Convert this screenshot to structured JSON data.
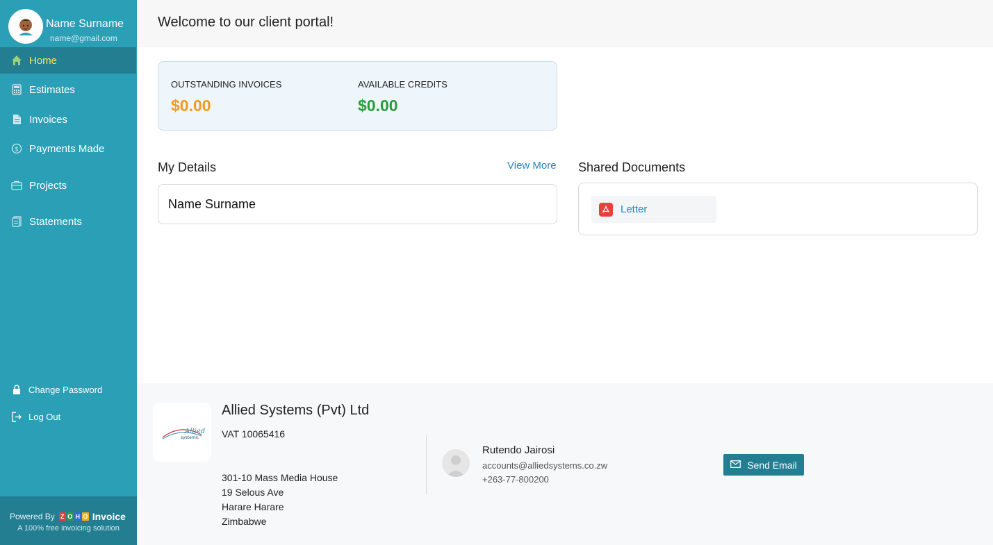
{
  "user": {
    "name": "Name Surname",
    "email": "name@gmail.com"
  },
  "sidebar": {
    "items": [
      {
        "label": "Home",
        "icon": "home-icon",
        "active": true
      },
      {
        "label": "Estimates",
        "icon": "calculator-icon"
      },
      {
        "label": "Invoices",
        "icon": "document-icon"
      },
      {
        "label": "Payments Made",
        "icon": "dollar-circle-icon"
      },
      {
        "label": "Projects",
        "icon": "briefcase-icon"
      },
      {
        "label": "Statements",
        "icon": "statement-icon"
      }
    ],
    "bottom": [
      {
        "label": "Change Password",
        "icon": "lock-icon"
      },
      {
        "label": "Log Out",
        "icon": "logout-icon"
      }
    ],
    "powered_by": {
      "text": "Powered By",
      "brand": "Invoice",
      "zoho_letters": [
        "Z",
        "O",
        "H",
        "O"
      ],
      "subtitle": "A 100% free invoicing solution"
    }
  },
  "header": {
    "title": "Welcome to our client portal!"
  },
  "summary": {
    "outstanding_label": "OUTSTANDING INVOICES",
    "outstanding_value": "$0.00",
    "credits_label": "AVAILABLE CREDITS",
    "credits_value": "$0.00"
  },
  "details": {
    "title": "My Details",
    "view_more": "View More",
    "name": "Name Surname"
  },
  "documents": {
    "title": "Shared Documents",
    "items": [
      {
        "name": "Letter",
        "icon": "pdf-icon"
      }
    ]
  },
  "footer": {
    "company": "Allied Systems (Pvt) Ltd",
    "vat": "VAT 10065416",
    "address": [
      "301-10 Mass Media House",
      "19 Selous Ave",
      "Harare Harare",
      "Zimbabwe"
    ],
    "contact": {
      "name": "Rutendo Jairosi",
      "email": "accounts@alliedsystems.co.zw",
      "phone": "+263-77-800200"
    },
    "send_email": "Send Email",
    "logo_text": "Allied systems."
  },
  "colors": {
    "sidebar": "#2a9fb6",
    "sidebar_active": "#237e92",
    "accent_yellow": "#f3e85a",
    "orange": "#f29b1d",
    "green": "#2a9c3a",
    "link": "#1f88c8"
  }
}
